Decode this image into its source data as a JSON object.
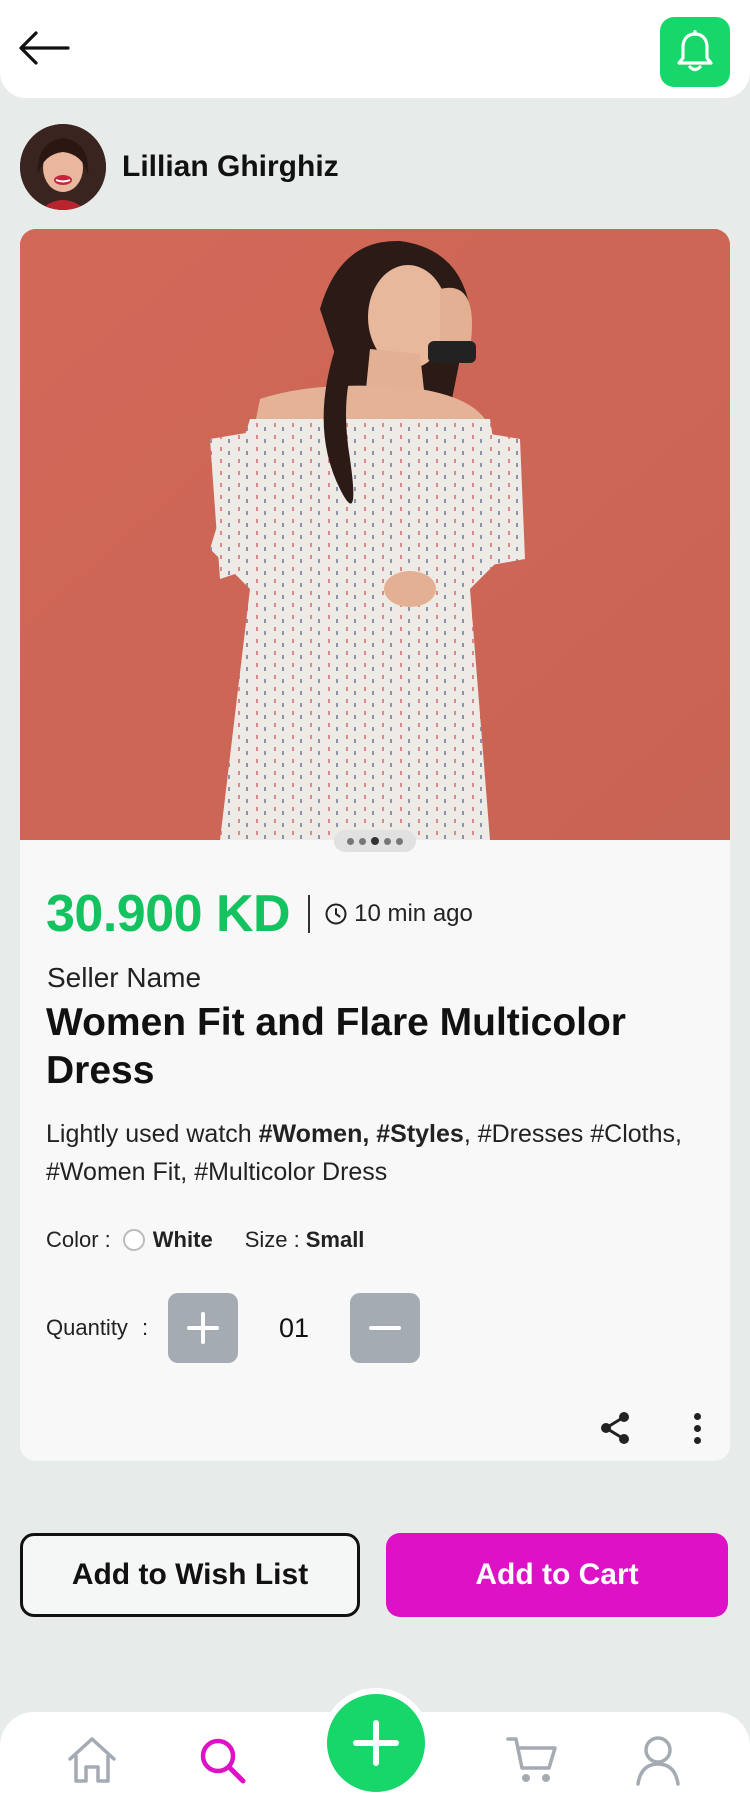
{
  "header": {
    "back_icon": "arrow-left-icon",
    "notification_icon": "bell-icon"
  },
  "seller": {
    "name": "Lillian Ghirghiz"
  },
  "product": {
    "price": "30.900 KD",
    "posted_time": "10 min ago",
    "seller_label": "Seller Name",
    "title": "Women Fit and Flare Multicolor Dress",
    "description_text": "Lightly used watch ",
    "tags_bold_1": "#Women,",
    "tags_bold_2": "#Styles",
    "tags_rest": ", #Dresses #Cloths, #Women Fit, #Multicolor Dress",
    "color_label": "Color :",
    "color_value": "White",
    "size_label": "Size :",
    "size_value": "Small",
    "quantity_label": "Quantity",
    "quantity_colon": ":",
    "quantity_value": "01",
    "image_slides": 5,
    "active_slide": 3
  },
  "actions": {
    "wishlist": "Add to Wish List",
    "cart": "Add to Cart"
  },
  "colors": {
    "green": "#17d66a",
    "price_green": "#14c35f",
    "magenta": "#dd12c6",
    "stepper_gray": "#a4abb3"
  },
  "bottom_nav": {
    "items": [
      "home-icon",
      "search-icon",
      "add-icon",
      "cart-icon",
      "profile-icon"
    ],
    "active": "search-icon"
  }
}
